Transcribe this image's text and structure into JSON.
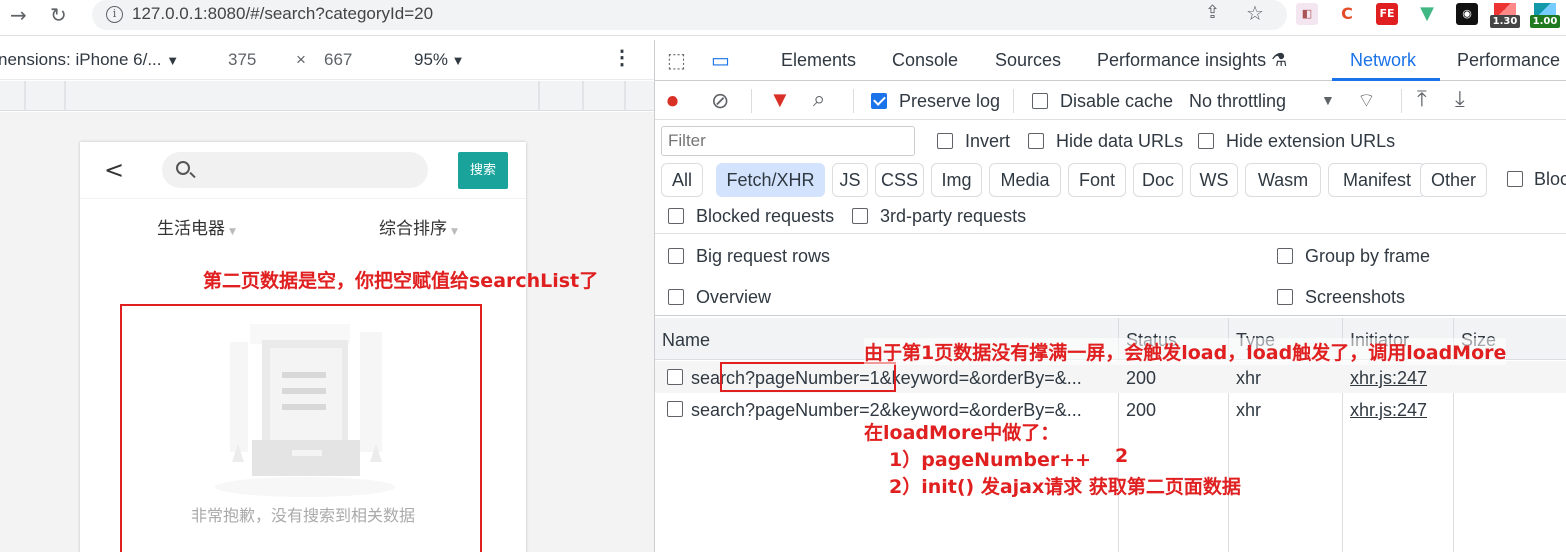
{
  "browser": {
    "url": "127.0.0.1:8080/#/search?categoryId=20",
    "ext_badges": [
      "1.30",
      "1.00"
    ]
  },
  "device_toolbar": {
    "device": "nensions: iPhone 6/...",
    "width": "375",
    "times": "×",
    "height": "667",
    "zoom": "95%"
  },
  "phone": {
    "search_button": "搜索",
    "filters": [
      "生活电器",
      "综合排序"
    ],
    "empty_text": "非常抱歉，没有搜索到相关数据"
  },
  "devtools": {
    "tabs": [
      "Elements",
      "Console",
      "Sources",
      "Performance insights",
      "Network",
      "Performance"
    ],
    "active_tab": "Network",
    "toolbar": {
      "preserve_log": "Preserve log",
      "disable_cache": "Disable cache",
      "throttling": "No throttling"
    },
    "filter": {
      "placeholder": "Filter",
      "invert": "Invert",
      "hide_data_urls": "Hide data URLs",
      "hide_ext_urls": "Hide extension URLs"
    },
    "types": [
      "All",
      "Fetch/XHR",
      "JS",
      "CSS",
      "Img",
      "Media",
      "Font",
      "Doc",
      "WS",
      "Wasm",
      "Manifest",
      "Other"
    ],
    "blocked_cookies": "Bloc",
    "blocked_requests": "Blocked requests",
    "third_party": "3rd-party requests",
    "big_rows": "Big request rows",
    "group_by_frame": "Group by frame",
    "overview": "Overview",
    "screenshots": "Screenshots",
    "columns": [
      "Name",
      "Status",
      "Type",
      "Initiator",
      "Size"
    ],
    "rows": [
      {
        "name": "search?pageNumber=1&keyword=&orderBy=&...",
        "status": "200",
        "type": "xhr",
        "initiator": "xhr.js:247"
      },
      {
        "name": "search?pageNumber=2&keyword=&orderBy=&...",
        "status": "200",
        "type": "xhr",
        "initiator": "xhr.js:247"
      }
    ]
  },
  "annotations": {
    "left": "第二页数据是空，你把空赋值给searchList了",
    "right_top": "由于第1页数据没有撑满一屏，会触发load，load触发了，调用loadMore",
    "right_mid": "在loadMore中做了：",
    "step1": "1）pageNumber++",
    "step1_val": "2",
    "step2": "2）init()   发ajax请求  获取第二页面数据"
  }
}
